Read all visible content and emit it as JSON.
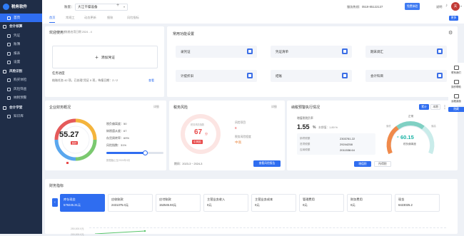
{
  "app": {
    "name": "税务软件"
  },
  "sidebar": {
    "items": [
      {
        "label": "首页",
        "type": "item",
        "active": true
      },
      {
        "label": "会计核算",
        "type": "group"
      },
      {
        "label": "凭证",
        "type": "item"
      },
      {
        "label": "账簿",
        "type": "item"
      },
      {
        "label": "报表",
        "type": "item"
      },
      {
        "label": "设置",
        "type": "item"
      },
      {
        "label": "风险识别",
        "type": "group"
      },
      {
        "label": "购买体检",
        "type": "item"
      },
      {
        "label": "风险筛查",
        "type": "item"
      },
      {
        "label": "纳税预警",
        "type": "item"
      },
      {
        "label": "会计学堂",
        "type": "group"
      },
      {
        "label": "知识库",
        "type": "item"
      }
    ]
  },
  "header": {
    "account_prefix": "账套：",
    "account_name": "大江干燥设备",
    "add_symbol": "+",
    "hotline": "服务热线：0519-85122137",
    "user_label": "免费体验",
    "help": "说明",
    "avatar_text": "天"
  },
  "tabs": [
    {
      "label": "首页",
      "active": true
    },
    {
      "label": "常规工"
    },
    {
      "label": "动态更新"
    },
    {
      "label": "细账"
    },
    {
      "label": "风险指标"
    }
  ],
  "tabs_button": "更多",
  "welcome": {
    "title": "欢迎使用！",
    "subtitle": "账套启用日期 2024 - 4",
    "add_voucher": "添加凭证",
    "tasks_title": "任务进度",
    "tasks_text": "结账任务 42 项，已处理 凭证 0 项，待报日期：2 / 2",
    "tasks_link": "查看"
  },
  "functions": {
    "title": "常用功能设置",
    "items": [
      "录凭证",
      "凭证清单",
      "期末调汇",
      "计提折旧",
      "结账",
      "会计科目"
    ]
  },
  "overview": {
    "title": "企业财务概况",
    "link": "详细",
    "score": "55.27",
    "score_tag": "良好",
    "stats": [
      "税负偏离度：50",
      "纳税遵从度：67",
      "存货周转率：69%",
      "风险指数：31%"
    ],
    "slider_value": 0.68,
    "foot_note": "数据截止至2024年4月"
  },
  "risk": {
    "title": "税务风险",
    "link": "详细",
    "score": "67",
    "score_unit": "分",
    "score_top": "税务风险指数",
    "score_level": "中风险",
    "label_1": "风险项目",
    "value_1": "8",
    "label_2": "税务风险程度",
    "value_2": "中高",
    "period": "期间：2023-3 ~ 2024-3",
    "button": "查看风险报告"
  },
  "declare": {
    "title": "纳税预警执行情况",
    "btn_a": "累计",
    "btn_b": "本期",
    "tax_label": "增值税税负率",
    "tax_value": "1.55",
    "tax_unit": "%",
    "compare": "本期值：1.89 %",
    "rows": [
      {
        "label": "销项税额",
        "value": "2303781.22"
      },
      {
        "label": "进项税额",
        "value": "29244258"
      },
      {
        "label": "应纳税额",
        "value": "2011538.64"
      }
    ],
    "gauge_value": "60.15",
    "gauge_value_sign": "-",
    "gauge_caption": "税负偏离度",
    "gauge_top_label": "正常",
    "gauge_left_label": "偏低",
    "gauge_right_label": "偏高",
    "tab_a": "增值税",
    "tab_b": "所得税"
  },
  "finance": {
    "title": "财务指标",
    "items": [
      {
        "label": "库存现金",
        "value": "579245.31元",
        "active": true
      },
      {
        "label": "应收账款",
        "value": "2431375.0元"
      },
      {
        "label": "应付账款",
        "value": "152545.93元"
      },
      {
        "label": "主营业务收入",
        "value": "0元"
      },
      {
        "label": "主营业务成本",
        "value": "0元"
      },
      {
        "label": "管理费用",
        "value": "0元"
      },
      {
        "label": "财务费用",
        "value": "0元"
      },
      {
        "label": "现金",
        "value": "6423025.2"
      }
    ],
    "chart_y_labels": [
      "250,000.0元",
      "200,000.0元"
    ]
  },
  "right_tools": [
    {
      "label": "联系我们"
    },
    {
      "label": "操作帮助"
    },
    {
      "label": "远程桌面"
    }
  ],
  "right_tools_button": "隐藏",
  "colors": {
    "primary": "#2f6df0",
    "sidebar": "#1f2d47",
    "danger": "#e84a4a",
    "teal": "#17b2a4"
  }
}
